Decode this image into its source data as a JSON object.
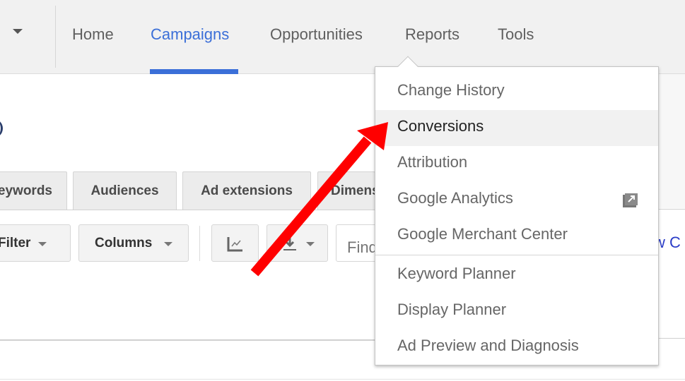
{
  "topnav": {
    "items": [
      {
        "label": "Home",
        "active": false
      },
      {
        "label": "Campaigns",
        "active": true
      },
      {
        "label": "Opportunities",
        "active": false
      },
      {
        "label": "Reports",
        "active": false
      },
      {
        "label": "Tools",
        "active": false
      }
    ],
    "accent_color": "#3b6fd8"
  },
  "tabs": [
    {
      "label": "Keywords"
    },
    {
      "label": "Audiences"
    },
    {
      "label": "Ad extensions"
    },
    {
      "label": "Dimensions"
    }
  ],
  "toolbar": {
    "filter_label": "Filter",
    "columns_label": "Columns",
    "chart_icon": "line-chart-icon",
    "download_icon": "download-icon",
    "find_placeholder": "Find"
  },
  "partial_link": "w C",
  "reports_menu": {
    "items": [
      {
        "label": "Change History",
        "highlighted": false
      },
      {
        "label": "Conversions",
        "highlighted": true
      },
      {
        "label": "Attribution",
        "highlighted": false
      },
      {
        "label": "Google Analytics",
        "highlighted": false,
        "icon": "external-link-icon"
      },
      {
        "label": "Google Merchant Center",
        "highlighted": false
      }
    ],
    "items_group2": [
      {
        "label": "Keyword Planner"
      },
      {
        "label": "Display Planner"
      },
      {
        "label": "Ad Preview and Diagnosis"
      }
    ]
  },
  "annotation": {
    "type": "arrow",
    "color": "#ff0000",
    "points_to": "Conversions"
  }
}
